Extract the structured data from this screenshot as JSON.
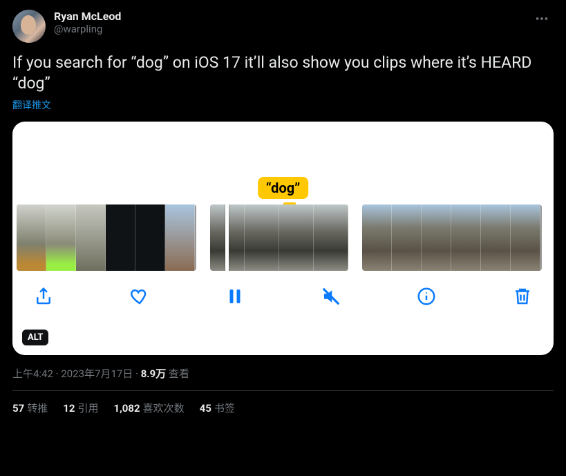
{
  "author": {
    "display_name": "Ryan McLeod",
    "handle": "@warpling"
  },
  "tweet_text": "If you search for “dog” on iOS 17 it’ll also show you clips where it’s HEARD “dog”",
  "translate_label": "翻译推文",
  "media": {
    "bubble_text": "“dog”",
    "alt_badge": "ALT"
  },
  "meta": {
    "time": "上午4:42",
    "sep": " · ",
    "date": "2023年7月17日",
    "views_value": "8.9万",
    "views_label": " 查看"
  },
  "stats": {
    "retweets_n": "57",
    "retweets_label": "转推",
    "quotes_n": "12",
    "quotes_label": "引用",
    "likes_n": "1,082",
    "likes_label": "喜欢次数",
    "bookmarks_n": "45",
    "bookmarks_label": "书签"
  }
}
